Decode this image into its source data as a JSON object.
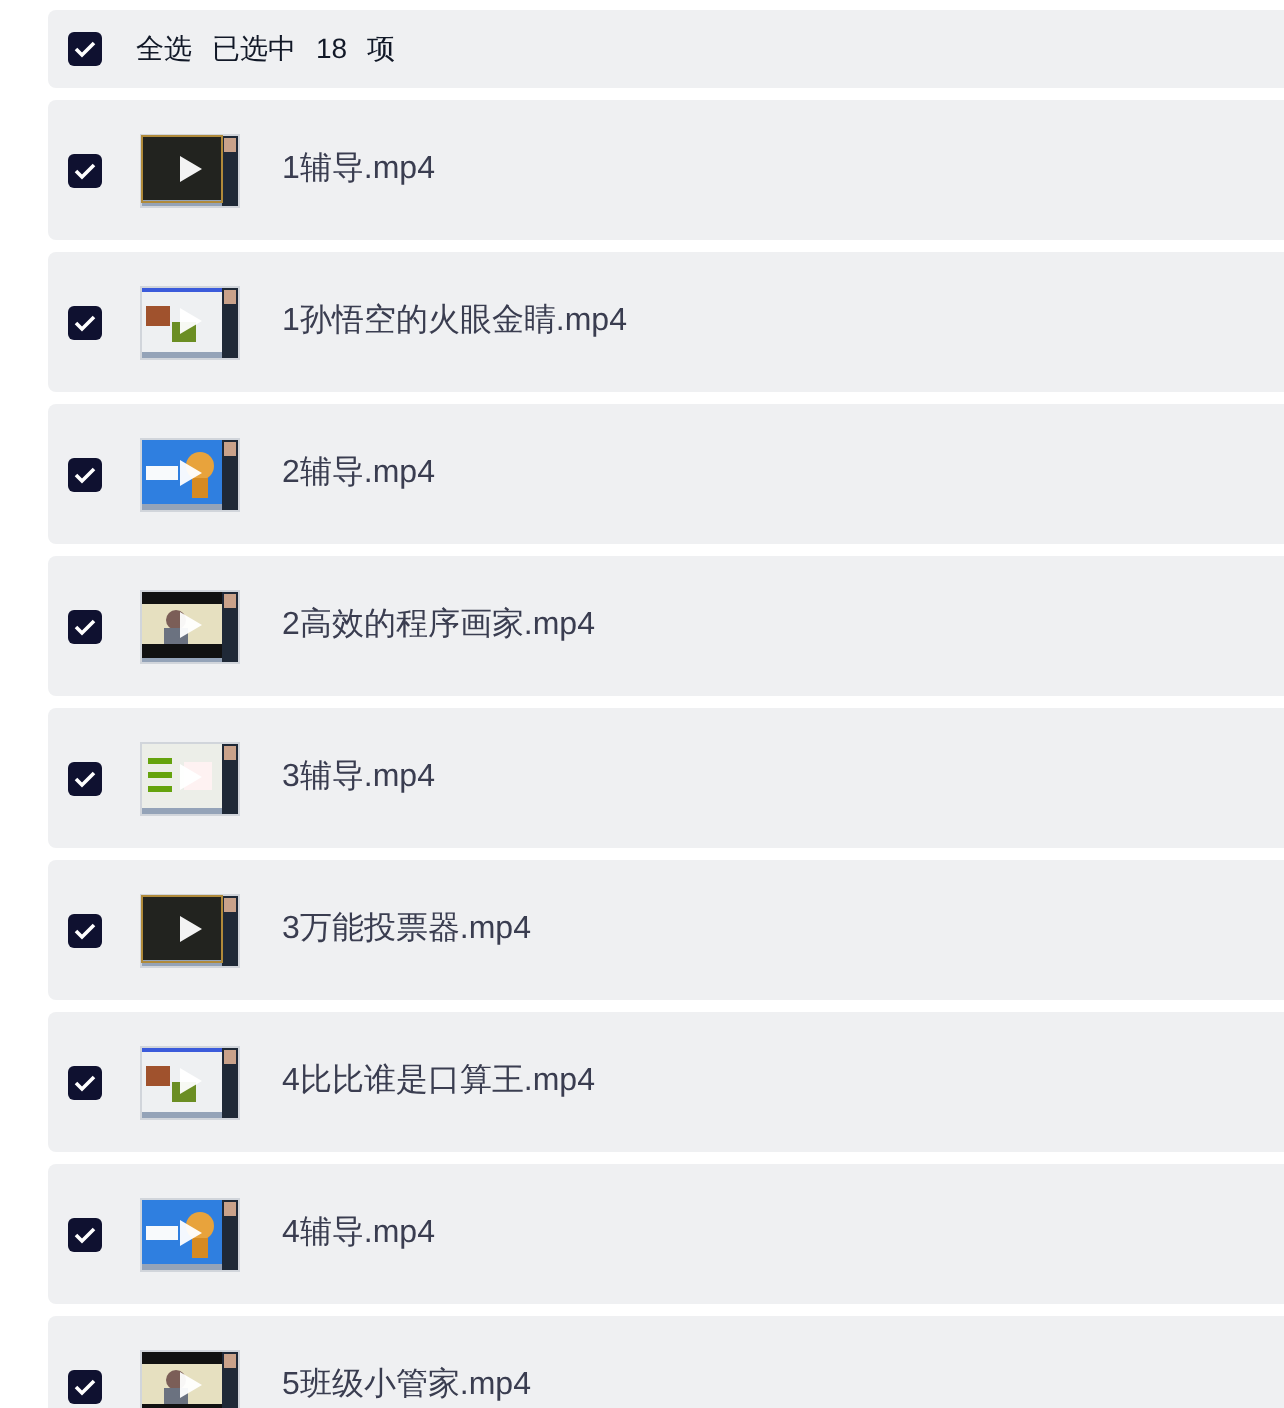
{
  "select_all": {
    "checked": true,
    "label": "全选",
    "summary": "已选中",
    "count": "18",
    "unit": "项"
  },
  "files": [
    {
      "name": "1辅导.mp4",
      "checked": true
    },
    {
      "name": "1孙悟空的火眼金睛.mp4",
      "checked": true
    },
    {
      "name": "2辅导.mp4",
      "checked": true
    },
    {
      "name": "2高效的程序画家.mp4",
      "checked": true
    },
    {
      "name": "3辅导.mp4",
      "checked": true
    },
    {
      "name": "3万能投票器.mp4",
      "checked": true
    },
    {
      "name": "4比比谁是口算王.mp4",
      "checked": true
    },
    {
      "name": "4辅导.mp4",
      "checked": true
    },
    {
      "name": "5班级小管家.mp4",
      "checked": true
    }
  ]
}
